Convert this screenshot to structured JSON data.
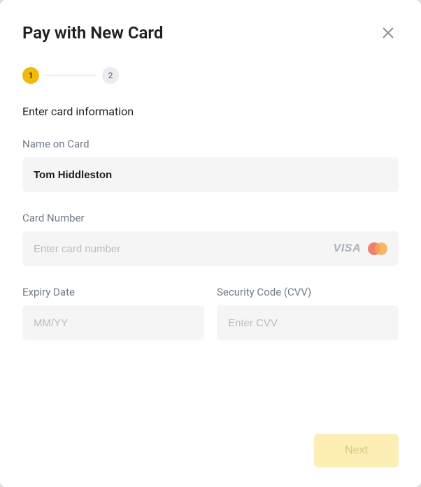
{
  "modal": {
    "title": "Pay with New Card"
  },
  "stepper": {
    "step1": "1",
    "step2": "2"
  },
  "section": {
    "heading": "Enter card information"
  },
  "fields": {
    "name": {
      "label": "Name on Card",
      "value": "Tom Hiddleston"
    },
    "cardNumber": {
      "label": "Card Number",
      "placeholder": "Enter card number",
      "value": ""
    },
    "expiry": {
      "label": "Expiry Date",
      "placeholder": "MM/YY",
      "value": ""
    },
    "cvv": {
      "label": "Security Code (CVV)",
      "placeholder": "Enter CVV",
      "value": ""
    }
  },
  "icons": {
    "visa": "VISA"
  },
  "actions": {
    "next": "Next"
  }
}
